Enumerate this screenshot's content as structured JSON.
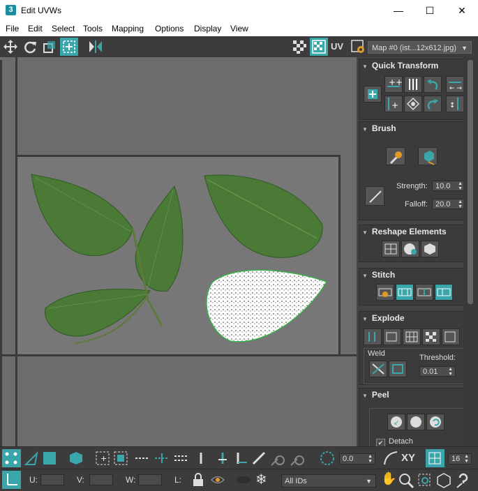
{
  "window": {
    "title": "Edit UVWs",
    "app_icon": "3",
    "minimize": "—",
    "maximize": "☐",
    "close": "✕"
  },
  "menu": [
    "File",
    "Edit",
    "Select",
    "Tools",
    "Mapping",
    "Options",
    "Display",
    "View"
  ],
  "toolbar": {
    "uv_label": "UV",
    "map_select": "Map #0 (ist...12x612.jpg)"
  },
  "panel": {
    "quick_transform": {
      "title": "Quick Transform"
    },
    "brush": {
      "title": "Brush",
      "strength_label": "Strength:",
      "strength_value": "10.0",
      "falloff_label": "Falloff:",
      "falloff_value": "20.0"
    },
    "reshape": {
      "title": "Reshape Elements"
    },
    "stitch": {
      "title": "Stitch"
    },
    "explode": {
      "title": "Explode",
      "weld_label": "Weld",
      "threshold_label": "Threshold:",
      "threshold_value": "0.01"
    },
    "peel": {
      "title": "Peel",
      "detach_label": "Detach",
      "detach_checked": "✔"
    }
  },
  "bottom_toolbar": {
    "rotate_value": "0.0",
    "xy_label": "XY",
    "grid_value": "16"
  },
  "status_bar": {
    "u_label": "U:",
    "v_label": "V:",
    "w_label": "W:",
    "l_label": "L:",
    "ids_select": "All IDs"
  },
  "colors": {
    "accent": "#3aa6aa",
    "viewport_bg": "#6c6c6c",
    "panel_bg": "#444444"
  }
}
